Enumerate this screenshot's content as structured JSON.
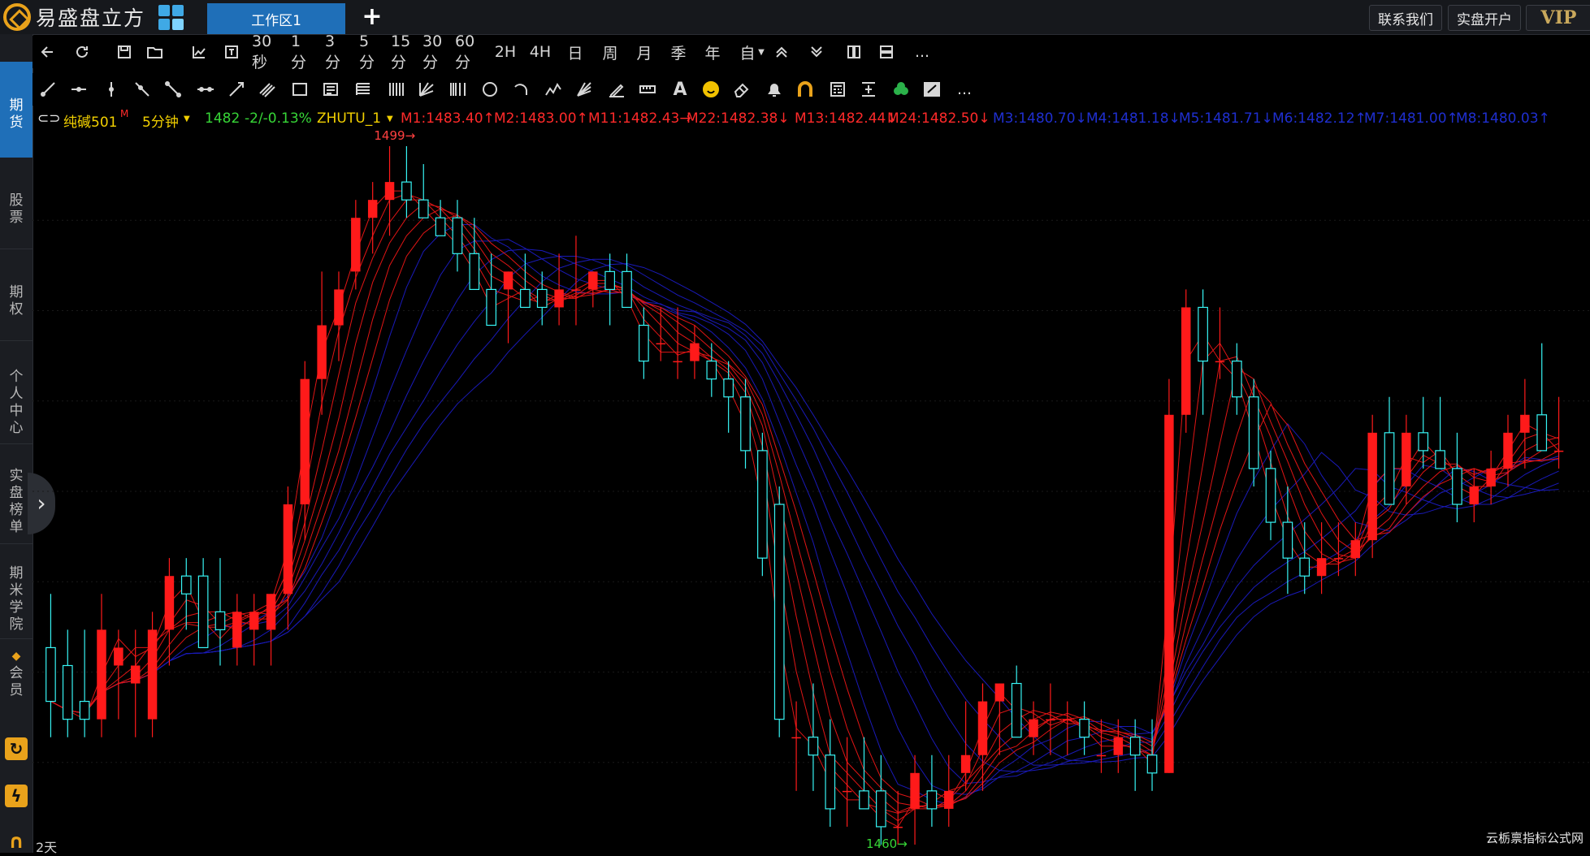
{
  "topbar": {
    "brand": "易盛盘立方",
    "workspace_tab": "工作区1",
    "add_tab": "+",
    "contact_label": "联系我们",
    "open_account_label": "实盘开户",
    "vip_label": "VIP"
  },
  "sidebar": {
    "items": [
      {
        "label": "期货"
      },
      {
        "label": "股票"
      },
      {
        "label": "期权"
      },
      {
        "label": "个人中心"
      },
      {
        "label": "实盘榜单"
      },
      {
        "label": "期米学院"
      },
      {
        "label": "会员"
      }
    ],
    "expand_arrow": "›"
  },
  "toolbar": {
    "periods": [
      "30秒",
      "1分",
      "3分",
      "5分",
      "15分",
      "30分",
      "60分",
      "2H",
      "4H",
      "日",
      "周",
      "月",
      "季",
      "年",
      "自"
    ],
    "more": "...",
    "drawing_more": "..."
  },
  "status": {
    "contract": "纯碱501",
    "contract_flag": "M",
    "period": "5分钟",
    "price": "1482",
    "change": "-2/-0.13%",
    "indicator": "ZHUTU_1",
    "ma_red": [
      "M1:1483.40↑",
      "M2:1483.00↑",
      "M11:1482.43→",
      "M22:1482.38↓",
      "M13:1482.44↓",
      "M24:1482.50↓"
    ],
    "ma_blue": [
      "M3:1480.70↓",
      "M4:1481.18↓",
      "M5:1481.71↓",
      "M6:1482.12↑",
      "M7:1481.00↑",
      "M8:1480.03↑"
    ]
  },
  "chart_data": {
    "type": "candlestick",
    "high_marker": "1499",
    "low_marker": "1460",
    "colors": {
      "up": "#ff1a1a",
      "down": "#37f4f4",
      "ma_red": "#e01515",
      "ma_blue": "#1a1ab8",
      "background": "#000000"
    },
    "ohlc": [
      [
        1471,
        1474,
        1466,
        1468
      ],
      [
        1470,
        1472,
        1466,
        1467
      ],
      [
        1468,
        1472,
        1466,
        1467
      ],
      [
        1467,
        1474,
        1466,
        1472
      ],
      [
        1470,
        1472,
        1467,
        1471
      ],
      [
        1469,
        1472,
        1466,
        1470
      ],
      [
        1467,
        1473,
        1466,
        1472
      ],
      [
        1472,
        1476,
        1470,
        1475
      ],
      [
        1475,
        1476,
        1472,
        1474
      ],
      [
        1475,
        1476,
        1472,
        1471
      ],
      [
        1473,
        1476,
        1470,
        1472
      ],
      [
        1471,
        1474,
        1470,
        1473
      ],
      [
        1472,
        1474,
        1470,
        1473
      ],
      [
        1472,
        1474,
        1470,
        1474
      ],
      [
        1474,
        1480,
        1472,
        1479
      ],
      [
        1479,
        1487,
        1477,
        1486
      ],
      [
        1486,
        1492,
        1484,
        1489
      ],
      [
        1489,
        1492,
        1487,
        1491
      ],
      [
        1492,
        1496,
        1491,
        1495
      ],
      [
        1495,
        1497,
        1493,
        1496
      ],
      [
        1496,
        1499,
        1494,
        1497
      ],
      [
        1497,
        1499,
        1495,
        1496
      ],
      [
        1496,
        1498,
        1495,
        1495
      ],
      [
        1495,
        1496,
        1494,
        1494
      ],
      [
        1495,
        1496,
        1492,
        1493
      ],
      [
        1493,
        1495,
        1491,
        1491
      ],
      [
        1491,
        1493,
        1490,
        1489
      ],
      [
        1491,
        1492,
        1488,
        1492
      ],
      [
        1491,
        1493,
        1490,
        1490
      ],
      [
        1491,
        1492,
        1489,
        1490
      ],
      [
        1490,
        1493,
        1489,
        1491
      ],
      [
        1491,
        1494,
        1489,
        1491
      ],
      [
        1491,
        1492,
        1490,
        1492
      ],
      [
        1492,
        1493,
        1489,
        1491
      ],
      [
        1492,
        1493,
        1490,
        1490
      ],
      [
        1489,
        1490,
        1486,
        1487
      ],
      [
        1488,
        1490,
        1487,
        1488
      ],
      [
        1487,
        1490,
        1486,
        1487
      ],
      [
        1487,
        1489,
        1486,
        1488
      ],
      [
        1487,
        1488,
        1485,
        1486
      ],
      [
        1486,
        1487,
        1483,
        1485
      ],
      [
        1485,
        1486,
        1481,
        1482
      ],
      [
        1482,
        1483,
        1475,
        1476
      ],
      [
        1479,
        1480,
        1466,
        1467
      ],
      [
        1466,
        1468,
        1463,
        1466
      ],
      [
        1466,
        1469,
        1463,
        1465
      ],
      [
        1465,
        1467,
        1461,
        1462
      ],
      [
        1463,
        1466,
        1461,
        1463
      ],
      [
        1463,
        1466,
        1462,
        1462
      ],
      [
        1463,
        1465,
        1460,
        1461
      ],
      [
        1461,
        1463,
        1460,
        1461
      ],
      [
        1462,
        1465,
        1460,
        1464
      ],
      [
        1463,
        1465,
        1461,
        1462
      ],
      [
        1462,
        1465,
        1461,
        1463
      ],
      [
        1464,
        1468,
        1463,
        1465
      ],
      [
        1465,
        1469,
        1463,
        1468
      ],
      [
        1468,
        1469,
        1465,
        1469
      ],
      [
        1469,
        1470,
        1466,
        1466
      ],
      [
        1466,
        1468,
        1465,
        1467
      ],
      [
        1467,
        1469,
        1465,
        1467
      ],
      [
        1467,
        1468,
        1465,
        1467
      ],
      [
        1467,
        1468,
        1465,
        1466
      ],
      [
        1465,
        1467,
        1464,
        1465
      ],
      [
        1465,
        1467,
        1464,
        1466
      ],
      [
        1466,
        1467,
        1463,
        1465
      ],
      [
        1465,
        1467,
        1463,
        1464
      ],
      [
        1464,
        1486,
        1464,
        1484
      ],
      [
        1484,
        1491,
        1483,
        1490
      ],
      [
        1490,
        1491,
        1484,
        1487
      ],
      [
        1487,
        1490,
        1486,
        1487
      ],
      [
        1487,
        1488,
        1484,
        1485
      ],
      [
        1485,
        1486,
        1480,
        1481
      ],
      [
        1481,
        1482,
        1477,
        1478
      ],
      [
        1478,
        1480,
        1474,
        1476
      ],
      [
        1476,
        1478,
        1474,
        1475
      ],
      [
        1475,
        1478,
        1474,
        1476
      ],
      [
        1476,
        1478,
        1475,
        1476
      ],
      [
        1476,
        1478,
        1475,
        1477
      ],
      [
        1477,
        1484,
        1476,
        1483
      ],
      [
        1483,
        1485,
        1479,
        1479
      ],
      [
        1480,
        1484,
        1479,
        1483
      ],
      [
        1483,
        1485,
        1481,
        1482
      ],
      [
        1482,
        1485,
        1481,
        1481
      ],
      [
        1481,
        1483,
        1478,
        1479
      ],
      [
        1479,
        1481,
        1478,
        1480
      ],
      [
        1480,
        1482,
        1479,
        1481
      ],
      [
        1481,
        1484,
        1480,
        1483
      ],
      [
        1483,
        1486,
        1481,
        1484
      ],
      [
        1484,
        1488,
        1482,
        1482
      ],
      [
        1482,
        1485,
        1481,
        1482
      ]
    ]
  },
  "footer": {
    "day_label": "2天",
    "watermark": "云栃禀指标公式网"
  }
}
